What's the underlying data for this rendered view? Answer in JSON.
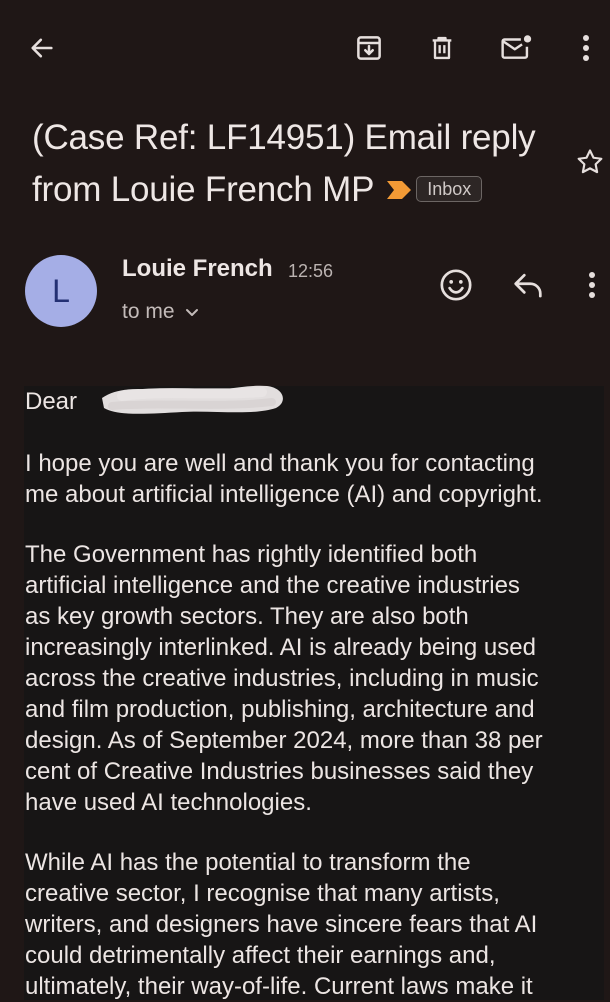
{
  "toolbar": {
    "icons": [
      "back-arrow-icon",
      "archive-icon",
      "delete-icon",
      "mark-unread-icon",
      "more-vert-icon"
    ]
  },
  "email": {
    "subject_lines": [
      "(Case Ref: LF14951) Email reply",
      "from Louie French MP"
    ],
    "label": "Inbox",
    "importance_color": "#f29a35"
  },
  "sender": {
    "avatar_initial": "L",
    "avatar_color": "#a5aee6",
    "name": "Louie French",
    "time": "12:56",
    "recipient": "to me"
  },
  "body": {
    "greeting": "Dear",
    "paragraphs": [
      [
        "I hope you are well and thank you for contacting",
        "me about artificial intelligence (AI) and copyright."
      ],
      [
        "The Government has rightly identified both",
        "artificial intelligence and the creative industries",
        "as key growth sectors. They are also both",
        "increasingly interlinked. AI is already being used",
        "across the creative industries, including in music",
        "and film production, publishing, architecture and",
        "design. As of September 2024, more than 38 per",
        "cent of Creative Industries businesses said they",
        "have used AI technologies."
      ],
      [
        "While AI has the potential to transform the",
        "creative sector, I recognise that many artists,",
        "writers, and designers have sincere fears that AI",
        "could detrimentally affect their earnings and,",
        "ultimately, their way-of-life. Current laws make it"
      ]
    ]
  }
}
